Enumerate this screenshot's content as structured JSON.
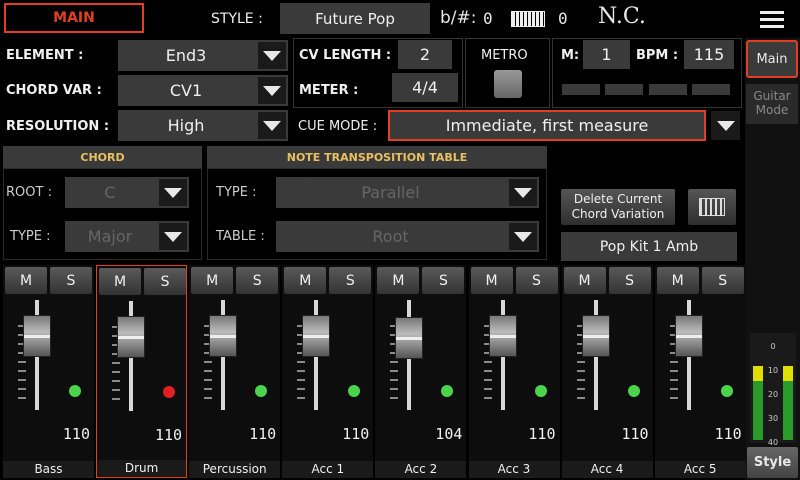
{
  "top": {
    "mode": "MAIN",
    "style_label": "STYLE :",
    "style_value": "Future Pop",
    "key_label": "b/#:",
    "key_value": "0",
    "transpose_value": "0",
    "chord": "N.C."
  },
  "element": {
    "label": "ELEMENT :",
    "value": "End3"
  },
  "chord_var": {
    "label": "CHORD VAR :",
    "value": "CV1"
  },
  "resolution": {
    "label": "RESOLUTION :",
    "value": "High"
  },
  "cv_length": {
    "label": "CV LENGTH :",
    "value": "2"
  },
  "meter": {
    "label": "METER :",
    "value": "4/4"
  },
  "metro": {
    "label": "METRO"
  },
  "measure": {
    "label": "M:",
    "value": "1"
  },
  "bpm": {
    "label": "BPM :",
    "value": "115"
  },
  "cue": {
    "label": "CUE MODE :",
    "value": "Immediate, first measure"
  },
  "chord_panel": {
    "title": "CHORD",
    "root_label": "ROOT :",
    "root_value": "C",
    "type_label": "TYPE :",
    "type_value": "Major"
  },
  "ntt_panel": {
    "title": "NOTE TRANSPOSITION TABLE",
    "type_label": "TYPE :",
    "type_value": "Parallel",
    "table_label": "TABLE :",
    "table_value": "Root"
  },
  "delete_btn": {
    "line1": "Delete Current",
    "line2": "Chord Variation"
  },
  "kit": "Pop Kit 1 Amb",
  "side": {
    "main": "Main",
    "guitar": "Guitar Mode",
    "style": "Style"
  },
  "meter_scale": [
    "0",
    "10",
    "20",
    "30",
    "40"
  ],
  "channels": [
    {
      "name": "Bass",
      "volume": "110",
      "m": "M",
      "s": "S",
      "active": "green",
      "level": 0.82
    },
    {
      "name": "Drum",
      "volume": "110",
      "m": "M",
      "s": "S",
      "active": "red",
      "level": 0.82
    },
    {
      "name": "Percussion",
      "volume": "110",
      "m": "M",
      "s": "S",
      "active": "green",
      "level": 0.82
    },
    {
      "name": "Acc 1",
      "volume": "110",
      "m": "M",
      "s": "S",
      "active": "green",
      "level": 0.82
    },
    {
      "name": "Acc 2",
      "volume": "104",
      "m": "M",
      "s": "S",
      "active": "green",
      "level": 0.78
    },
    {
      "name": "Acc 3",
      "volume": "110",
      "m": "M",
      "s": "S",
      "active": "green",
      "level": 0.82
    },
    {
      "name": "Acc 4",
      "volume": "110",
      "m": "M",
      "s": "S",
      "active": "green",
      "level": 0.82
    },
    {
      "name": "Acc 5",
      "volume": "110",
      "m": "M",
      "s": "S",
      "active": "green",
      "level": 0.82
    }
  ]
}
